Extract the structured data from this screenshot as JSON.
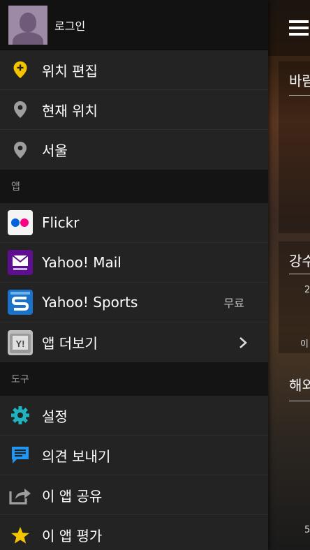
{
  "profile": {
    "name": "로그인"
  },
  "locations": [
    {
      "label": "위치 편집",
      "icon": "pin-add-icon"
    },
    {
      "label": "현재 위치",
      "icon": "pin-icon"
    },
    {
      "label": "서울",
      "icon": "pin-icon"
    }
  ],
  "sections": {
    "apps": "앱",
    "tools": "도구"
  },
  "apps": [
    {
      "label": "Flickr",
      "icon": "flickr-icon"
    },
    {
      "label": "Yahoo! Mail",
      "icon": "yahoo-mail-icon"
    },
    {
      "label": "Yahoo! Sports",
      "icon": "yahoo-sports-icon",
      "badge": "무료"
    },
    {
      "label": "앱 더보기",
      "icon": "yahoo-more-icon"
    }
  ],
  "tools": [
    {
      "label": "설정",
      "icon": "gear-icon"
    },
    {
      "label": "의견 보내기",
      "icon": "feedback-icon"
    },
    {
      "label": "이 앱 공유",
      "icon": "share-icon"
    },
    {
      "label": "이 앱 평가",
      "icon": "star-icon"
    }
  ],
  "background": {
    "card1_title": "바람",
    "card2_title": "강수",
    "card3_title": "해외",
    "small1": "이",
    "small2": "2",
    "small3": "5"
  },
  "colors": {
    "accent_yellow": "#f5c400",
    "teal": "#1fb2c0",
    "blue": "#2196f3"
  }
}
